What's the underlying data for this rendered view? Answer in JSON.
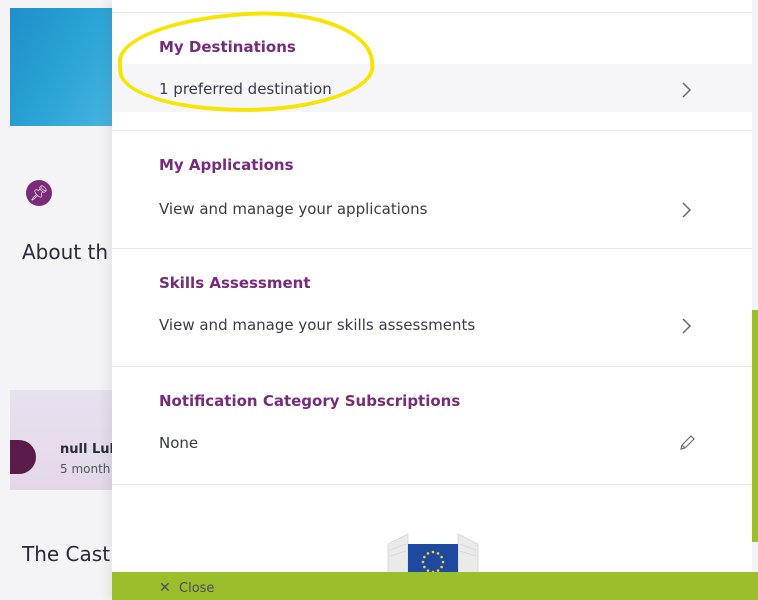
{
  "background": {
    "about_text": "About th",
    "author_name": "null Luk",
    "author_time": "5 month",
    "castle_text": "The Cast",
    "pin_icon": "pin-icon"
  },
  "panel": {
    "items": [
      {
        "title": "My Destinations",
        "subtitle": "1 preferred destination",
        "action_icon": "chevron-right-icon"
      },
      {
        "title": "My Applications",
        "subtitle": "View and manage your applications",
        "action_icon": "chevron-right-icon"
      },
      {
        "title": "Skills Assessment",
        "subtitle": "View and manage your skills assessments",
        "action_icon": "chevron-right-icon"
      },
      {
        "title": "Notification Category Subscriptions",
        "subtitle": "None",
        "action_icon": "pencil-icon"
      }
    ],
    "close_label": "Close"
  },
  "colors": {
    "title_purple": "#762b7b",
    "close_bar_green": "#9bbf2a",
    "highlight_yellow": "#f7e400",
    "eu_blue": "#1e49a0"
  }
}
